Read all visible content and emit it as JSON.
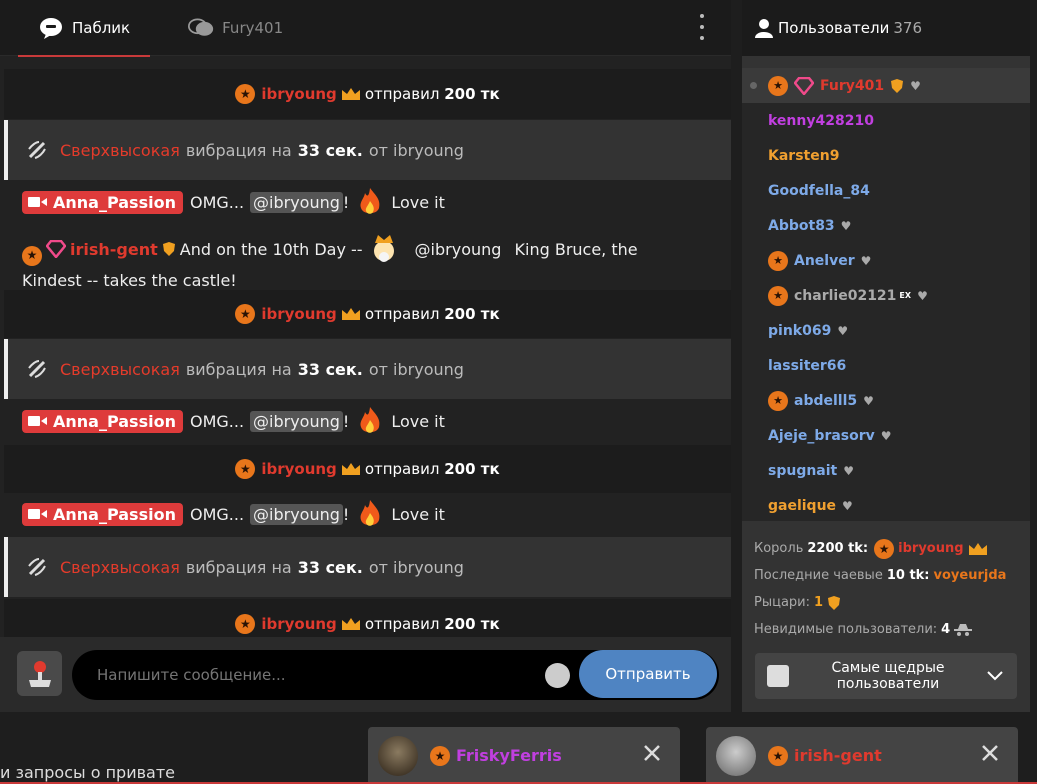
{
  "tabs": [
    {
      "label": "Паблик",
      "icon": "public-chat-icon"
    },
    {
      "label": "Fury401",
      "icon": "private-chat-icon"
    }
  ],
  "messages": {
    "tip": {
      "user": "ibryoung",
      "text": "отправил",
      "amount": "200 тк"
    },
    "vibration": {
      "level": "Сверхвысокая",
      "text1": "вибрация на",
      "duration": "33 сек.",
      "text2": "от ibryoung"
    },
    "model_msg": {
      "user": "Anna_Passion",
      "text": "OMG...",
      "mention": "@ibryoung",
      "bang": "!",
      "tail": "Love it"
    },
    "irish": {
      "user": "irish-gent",
      "text1": "And on the 10th Day --",
      "mention": "@ibryoung",
      "text2": "King Bruce, the",
      "text3": "Kindest -- takes the castle!"
    }
  },
  "input": {
    "placeholder": "Напишите сообщение...",
    "send_label": "Отправить"
  },
  "users": {
    "title": "Пользователи",
    "count": "376",
    "list": [
      {
        "name": "Fury401",
        "color": "#e03a2e"
      },
      {
        "name": "kenny428210",
        "color": "#c13fe0"
      },
      {
        "name": "Karsten9",
        "color": "#f0a030"
      },
      {
        "name": "Goodfella_84",
        "color": "#7eaae8"
      },
      {
        "name": "Abbot83",
        "color": "#7eaae8"
      },
      {
        "name": "Anelver",
        "color": "#7eaae8"
      },
      {
        "name": "charlie02121",
        "color": "#aaaaaa",
        "sup": "EX"
      },
      {
        "name": "pink069",
        "color": "#7eaae8"
      },
      {
        "name": "lassiter66",
        "color": "#7eaae8"
      },
      {
        "name": "abdelll5",
        "color": "#7eaae8"
      },
      {
        "name": "Ajeje_brasorv",
        "color": "#7eaae8"
      },
      {
        "name": "spugnait",
        "color": "#7eaae8"
      },
      {
        "name": "gaelique",
        "color": "#f0a030"
      }
    ],
    "stats": {
      "king_label": "Король",
      "king_amount": "2200 tk:",
      "king_user": "ibryoung",
      "last_tip_label": "Последние чаевые",
      "last_tip_amount": "10 tk:",
      "last_tip_user": "voyeurjda",
      "knights_label": "Рыцари:",
      "knights_count": "1",
      "invisible_label": "Невидимые пользователи:",
      "invisible_count": "4"
    },
    "top_button": "Самые щедрые пользователи"
  },
  "bottom": {
    "text": "и запросы о привате",
    "notifications": [
      {
        "user": "FriskyFerris",
        "color": "#c13fe0"
      },
      {
        "user": "irish-gent",
        "color": "#e03a2e"
      }
    ]
  }
}
